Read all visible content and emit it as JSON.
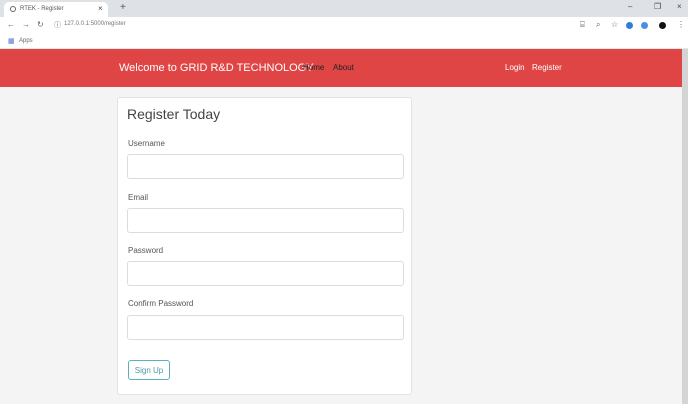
{
  "browser": {
    "tab_title": "RTEK - Register",
    "tab_close": "×",
    "new_tab": "+",
    "url": "127.0.0.1:5000/register",
    "bookmarks_label": "Apps",
    "window_controls": {
      "minimize": "–",
      "restore": "❐",
      "close": "×"
    }
  },
  "navbar": {
    "brand": "Welcome to GRID R&D TECHNOLOGY",
    "links": {
      "home": "Home",
      "about": "About",
      "login": "Login",
      "register": "Register"
    },
    "background_color": "#e04545"
  },
  "form": {
    "title": "Register Today",
    "fields": {
      "username": {
        "label": "Username",
        "value": ""
      },
      "email": {
        "label": "Email",
        "value": ""
      },
      "password": {
        "label": "Password",
        "value": ""
      },
      "confirm_password": {
        "label": "Confirm Password",
        "value": ""
      }
    },
    "submit_label": "Sign Up",
    "submit_color": "#5bb0bd"
  }
}
